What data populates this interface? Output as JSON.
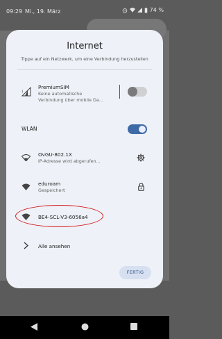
{
  "status_bar": {
    "time": "09:29",
    "date": "Mi., 19. März",
    "battery": "74 %"
  },
  "dialog": {
    "title": "Internet",
    "subtitle": "Tippe auf ein Netzwerk, um eine Verbindung herzustellen",
    "mobile": {
      "name": "PremiumSIM",
      "status_line1": "Keine automatische",
      "status_line2": "Verbindung über mobile Da...",
      "toggle_on": false
    },
    "wlan": {
      "label": "WLAN",
      "toggle_on": true
    },
    "networks": [
      {
        "name": "OvGU-802.1X",
        "status": "IP-Adresse wird abgerufen...",
        "icon": "settings-gear-icon"
      },
      {
        "name": "eduroam",
        "status": "Gespeichert",
        "icon": "lock-icon"
      },
      {
        "name": "BE4-SCL-V3-6056a4",
        "status": ""
      }
    ],
    "see_all": "Alle ansehen",
    "done_button": "FERTIG"
  },
  "colors": {
    "accent": "#3f6aa8",
    "highlight_ellipse": "#d11a1a",
    "dialog_bg": "#eef1f7"
  }
}
